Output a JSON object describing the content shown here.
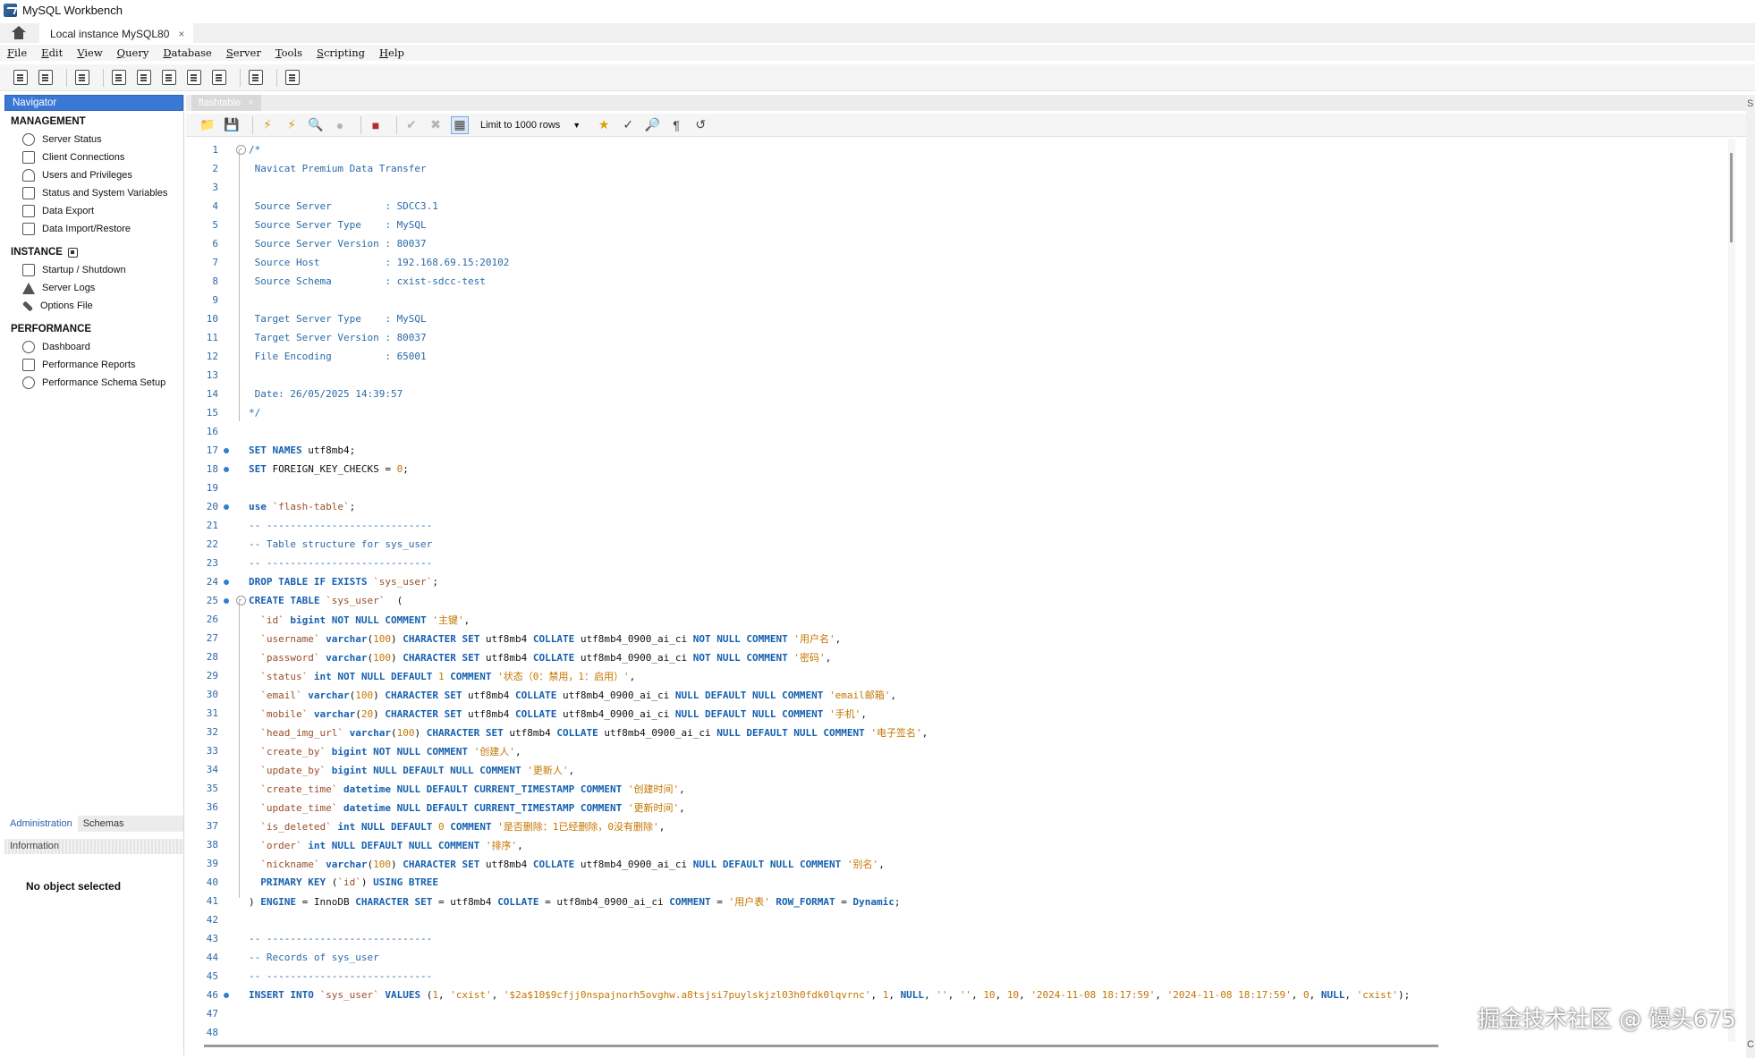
{
  "window": {
    "title": "MySQL Workbench"
  },
  "connection_tab": {
    "label": "Local instance MySQL80",
    "close": "×"
  },
  "menu": [
    {
      "mn": "F",
      "rest": "ile"
    },
    {
      "mn": "E",
      "rest": "dit"
    },
    {
      "mn": "V",
      "rest": "iew"
    },
    {
      "mn": "Q",
      "rest": "uery"
    },
    {
      "mn": "D",
      "rest": "atabase"
    },
    {
      "mn": "S",
      "rest": "erver"
    },
    {
      "mn": "T",
      "rest": "ools"
    },
    {
      "mn": "S",
      "rest": "cripting"
    },
    {
      "mn": "H",
      "rest": "elp"
    }
  ],
  "navigator": {
    "header": "Navigator",
    "management_title": "MANAGEMENT",
    "management": [
      "Server Status",
      "Client Connections",
      "Users and Privileges",
      "Status and System Variables",
      "Data Export",
      "Data Import/Restore"
    ],
    "instance_title": "INSTANCE",
    "instance": [
      "Startup / Shutdown",
      "Server Logs",
      "Options File"
    ],
    "performance_title": "PERFORMANCE",
    "performance": [
      "Dashboard",
      "Performance Reports",
      "Performance Schema Setup"
    ],
    "tabs": [
      "Administration",
      "Schemas"
    ],
    "info_header": "Information",
    "no_object": "No object selected"
  },
  "editor": {
    "tab_label": "flashtable",
    "tab_close": "×",
    "limit_label": "Limit to 1000 rows",
    "right_tab_text": "S",
    "right_tab_text2": "C"
  },
  "watermark": "掘金技术社区 @ 馒头675",
  "code_lines": [
    {
      "n": "1",
      "m": "",
      "f": "-",
      "t": [
        [
          "cm",
          "/*"
        ]
      ]
    },
    {
      "n": "2",
      "m": "",
      "f": "",
      "t": [
        [
          "cm",
          " Navicat Premium Data Transfer"
        ]
      ]
    },
    {
      "n": "3",
      "m": "",
      "f": "",
      "t": []
    },
    {
      "n": "4",
      "m": "",
      "f": "",
      "t": [
        [
          "cm",
          " Source Server         : SDCC3.1"
        ]
      ]
    },
    {
      "n": "5",
      "m": "",
      "f": "",
      "t": [
        [
          "cm",
          " Source Server Type    : MySQL"
        ]
      ]
    },
    {
      "n": "6",
      "m": "",
      "f": "",
      "t": [
        [
          "cm",
          " Source Server Version : 80037"
        ]
      ]
    },
    {
      "n": "7",
      "m": "",
      "f": "",
      "t": [
        [
          "cm",
          " Source Host           : 192.168.69.15:20102"
        ]
      ]
    },
    {
      "n": "8",
      "m": "",
      "f": "",
      "t": [
        [
          "cm",
          " Source Schema         : cxist-sdcc-test"
        ]
      ]
    },
    {
      "n": "9",
      "m": "",
      "f": "",
      "t": []
    },
    {
      "n": "10",
      "m": "",
      "f": "",
      "t": [
        [
          "cm",
          " Target Server Type    : MySQL"
        ]
      ]
    },
    {
      "n": "11",
      "m": "",
      "f": "",
      "t": [
        [
          "cm",
          " Target Server Version : 80037"
        ]
      ]
    },
    {
      "n": "12",
      "m": "",
      "f": "",
      "t": [
        [
          "cm",
          " File Encoding         : 65001"
        ]
      ]
    },
    {
      "n": "13",
      "m": "",
      "f": "",
      "t": []
    },
    {
      "n": "14",
      "m": "",
      "f": "",
      "t": [
        [
          "cm",
          " Date: 26/05/2025 14:39:57"
        ]
      ]
    },
    {
      "n": "15",
      "m": "",
      "f": "",
      "t": [
        [
          "cm",
          "*/"
        ]
      ]
    },
    {
      "n": "16",
      "m": "",
      "f": "",
      "t": []
    },
    {
      "n": "17",
      "m": "dot",
      "f": "",
      "t": [
        [
          "kw",
          "SET NAMES"
        ],
        [
          "pl",
          " utf8mb4;"
        ]
      ]
    },
    {
      "n": "18",
      "m": "dot",
      "f": "",
      "t": [
        [
          "kw",
          "SET"
        ],
        [
          "pl",
          " FOREIGN_KEY_CHECKS = "
        ],
        [
          "nm",
          "0"
        ],
        [
          "pl",
          ";"
        ]
      ]
    },
    {
      "n": "19",
      "m": "",
      "f": "",
      "t": []
    },
    {
      "n": "20",
      "m": "dot",
      "f": "",
      "t": [
        [
          "kw",
          "use"
        ],
        [
          "pl",
          " "
        ],
        [
          "id",
          "`flash-table`"
        ],
        [
          "pl",
          ";"
        ]
      ]
    },
    {
      "n": "21",
      "m": "",
      "f": "",
      "t": [
        [
          "cm",
          "-- ----------------------------"
        ]
      ]
    },
    {
      "n": "22",
      "m": "",
      "f": "",
      "t": [
        [
          "cm",
          "-- Table structure for sys_user"
        ]
      ]
    },
    {
      "n": "23",
      "m": "",
      "f": "",
      "t": [
        [
          "cm",
          "-- ----------------------------"
        ]
      ]
    },
    {
      "n": "24",
      "m": "dot",
      "f": "",
      "t": [
        [
          "kw",
          "DROP TABLE IF EXISTS"
        ],
        [
          "pl",
          " "
        ],
        [
          "id",
          "`sys_user`"
        ],
        [
          "pl",
          ";"
        ]
      ]
    },
    {
      "n": "25",
      "m": "dot",
      "f": "-",
      "t": [
        [
          "kw",
          "CREATE TABLE"
        ],
        [
          "pl",
          " "
        ],
        [
          "id",
          "`sys_user`"
        ],
        [
          "pl",
          "  ("
        ]
      ]
    },
    {
      "n": "26",
      "m": "",
      "f": "",
      "t": [
        [
          "pl",
          "  "
        ],
        [
          "id",
          "`id`"
        ],
        [
          "pl",
          " "
        ],
        [
          "kw",
          "bigint NOT NULL COMMENT"
        ],
        [
          "pl",
          " "
        ],
        [
          "st",
          "'主键'"
        ],
        [
          "pl",
          ","
        ]
      ]
    },
    {
      "n": "27",
      "m": "",
      "f": "",
      "t": [
        [
          "pl",
          "  "
        ],
        [
          "id",
          "`username`"
        ],
        [
          "pl",
          " "
        ],
        [
          "kw",
          "varchar"
        ],
        [
          "pl",
          "("
        ],
        [
          "nm",
          "100"
        ],
        [
          "pl",
          ") "
        ],
        [
          "kw",
          "CHARACTER SET"
        ],
        [
          "pl",
          " utf8mb4 "
        ],
        [
          "kw",
          "COLLATE"
        ],
        [
          "pl",
          " utf8mb4_0900_ai_ci "
        ],
        [
          "kw",
          "NOT NULL COMMENT"
        ],
        [
          "pl",
          " "
        ],
        [
          "st",
          "'用户名'"
        ],
        [
          "pl",
          ","
        ]
      ]
    },
    {
      "n": "28",
      "m": "",
      "f": "",
      "t": [
        [
          "pl",
          "  "
        ],
        [
          "id",
          "`password`"
        ],
        [
          "pl",
          " "
        ],
        [
          "kw",
          "varchar"
        ],
        [
          "pl",
          "("
        ],
        [
          "nm",
          "100"
        ],
        [
          "pl",
          ") "
        ],
        [
          "kw",
          "CHARACTER SET"
        ],
        [
          "pl",
          " utf8mb4 "
        ],
        [
          "kw",
          "COLLATE"
        ],
        [
          "pl",
          " utf8mb4_0900_ai_ci "
        ],
        [
          "kw",
          "NOT NULL COMMENT"
        ],
        [
          "pl",
          " "
        ],
        [
          "st",
          "'密码'"
        ],
        [
          "pl",
          ","
        ]
      ]
    },
    {
      "n": "29",
      "m": "",
      "f": "",
      "t": [
        [
          "pl",
          "  "
        ],
        [
          "id",
          "`status`"
        ],
        [
          "pl",
          " "
        ],
        [
          "kw",
          "int NOT NULL DEFAULT"
        ],
        [
          "pl",
          " "
        ],
        [
          "nm",
          "1"
        ],
        [
          "pl",
          " "
        ],
        [
          "kw",
          "COMMENT"
        ],
        [
          "pl",
          " "
        ],
        [
          "st",
          "'状态（0：禁用，1：启用）'"
        ],
        [
          "pl",
          ","
        ]
      ]
    },
    {
      "n": "30",
      "m": "",
      "f": "",
      "t": [
        [
          "pl",
          "  "
        ],
        [
          "id",
          "`email`"
        ],
        [
          "pl",
          " "
        ],
        [
          "kw",
          "varchar"
        ],
        [
          "pl",
          "("
        ],
        [
          "nm",
          "100"
        ],
        [
          "pl",
          ") "
        ],
        [
          "kw",
          "CHARACTER SET"
        ],
        [
          "pl",
          " utf8mb4 "
        ],
        [
          "kw",
          "COLLATE"
        ],
        [
          "pl",
          " utf8mb4_0900_ai_ci "
        ],
        [
          "kw",
          "NULL DEFAULT NULL COMMENT"
        ],
        [
          "pl",
          " "
        ],
        [
          "st",
          "'email邮箱'"
        ],
        [
          "pl",
          ","
        ]
      ]
    },
    {
      "n": "31",
      "m": "",
      "f": "",
      "t": [
        [
          "pl",
          "  "
        ],
        [
          "id",
          "`mobile`"
        ],
        [
          "pl",
          " "
        ],
        [
          "kw",
          "varchar"
        ],
        [
          "pl",
          "("
        ],
        [
          "nm",
          "20"
        ],
        [
          "pl",
          ") "
        ],
        [
          "kw",
          "CHARACTER SET"
        ],
        [
          "pl",
          " utf8mb4 "
        ],
        [
          "kw",
          "COLLATE"
        ],
        [
          "pl",
          " utf8mb4_0900_ai_ci "
        ],
        [
          "kw",
          "NULL DEFAULT NULL COMMENT"
        ],
        [
          "pl",
          " "
        ],
        [
          "st",
          "'手机'"
        ],
        [
          "pl",
          ","
        ]
      ]
    },
    {
      "n": "32",
      "m": "",
      "f": "",
      "t": [
        [
          "pl",
          "  "
        ],
        [
          "id",
          "`head_img_url`"
        ],
        [
          "pl",
          " "
        ],
        [
          "kw",
          "varchar"
        ],
        [
          "pl",
          "("
        ],
        [
          "nm",
          "100"
        ],
        [
          "pl",
          ") "
        ],
        [
          "kw",
          "CHARACTER SET"
        ],
        [
          "pl",
          " utf8mb4 "
        ],
        [
          "kw",
          "COLLATE"
        ],
        [
          "pl",
          " utf8mb4_0900_ai_ci "
        ],
        [
          "kw",
          "NULL DEFAULT NULL COMMENT"
        ],
        [
          "pl",
          " "
        ],
        [
          "st",
          "'电子签名'"
        ],
        [
          "pl",
          ","
        ]
      ]
    },
    {
      "n": "33",
      "m": "",
      "f": "",
      "t": [
        [
          "pl",
          "  "
        ],
        [
          "id",
          "`create_by`"
        ],
        [
          "pl",
          " "
        ],
        [
          "kw",
          "bigint NOT NULL COMMENT"
        ],
        [
          "pl",
          " "
        ],
        [
          "st",
          "'创建人'"
        ],
        [
          "pl",
          ","
        ]
      ]
    },
    {
      "n": "34",
      "m": "",
      "f": "",
      "t": [
        [
          "pl",
          "  "
        ],
        [
          "id",
          "`update_by`"
        ],
        [
          "pl",
          " "
        ],
        [
          "kw",
          "bigint NULL DEFAULT NULL COMMENT"
        ],
        [
          "pl",
          " "
        ],
        [
          "st",
          "'更新人'"
        ],
        [
          "pl",
          ","
        ]
      ]
    },
    {
      "n": "35",
      "m": "",
      "f": "",
      "t": [
        [
          "pl",
          "  "
        ],
        [
          "id",
          "`create_time`"
        ],
        [
          "pl",
          " "
        ],
        [
          "kw",
          "datetime NULL DEFAULT CURRENT_TIMESTAMP COMMENT"
        ],
        [
          "pl",
          " "
        ],
        [
          "st",
          "'创建时间'"
        ],
        [
          "pl",
          ","
        ]
      ]
    },
    {
      "n": "36",
      "m": "",
      "f": "",
      "t": [
        [
          "pl",
          "  "
        ],
        [
          "id",
          "`update_time`"
        ],
        [
          "pl",
          " "
        ],
        [
          "kw",
          "datetime NULL DEFAULT CURRENT_TIMESTAMP COMMENT"
        ],
        [
          "pl",
          " "
        ],
        [
          "st",
          "'更新时间'"
        ],
        [
          "pl",
          ","
        ]
      ]
    },
    {
      "n": "37",
      "m": "",
      "f": "",
      "t": [
        [
          "pl",
          "  "
        ],
        [
          "id",
          "`is_deleted`"
        ],
        [
          "pl",
          " "
        ],
        [
          "kw",
          "int NULL DEFAULT"
        ],
        [
          "pl",
          " "
        ],
        [
          "nm",
          "0"
        ],
        [
          "pl",
          " "
        ],
        [
          "kw",
          "COMMENT"
        ],
        [
          "pl",
          " "
        ],
        [
          "st",
          "'是否删除：1已经删除，0没有删除'"
        ],
        [
          "pl",
          ","
        ]
      ]
    },
    {
      "n": "38",
      "m": "",
      "f": "",
      "t": [
        [
          "pl",
          "  "
        ],
        [
          "id",
          "`order`"
        ],
        [
          "pl",
          " "
        ],
        [
          "kw",
          "int NULL DEFAULT NULL COMMENT"
        ],
        [
          "pl",
          " "
        ],
        [
          "st",
          "'排序'"
        ],
        [
          "pl",
          ","
        ]
      ]
    },
    {
      "n": "39",
      "m": "",
      "f": "",
      "t": [
        [
          "pl",
          "  "
        ],
        [
          "id",
          "`nickname`"
        ],
        [
          "pl",
          " "
        ],
        [
          "kw",
          "varchar"
        ],
        [
          "pl",
          "("
        ],
        [
          "nm",
          "100"
        ],
        [
          "pl",
          ") "
        ],
        [
          "kw",
          "CHARACTER SET"
        ],
        [
          "pl",
          " utf8mb4 "
        ],
        [
          "kw",
          "COLLATE"
        ],
        [
          "pl",
          " utf8mb4_0900_ai_ci "
        ],
        [
          "kw",
          "NULL DEFAULT NULL COMMENT"
        ],
        [
          "pl",
          " "
        ],
        [
          "st",
          "'别名'"
        ],
        [
          "pl",
          ","
        ]
      ]
    },
    {
      "n": "40",
      "m": "",
      "f": "",
      "t": [
        [
          "pl",
          "  "
        ],
        [
          "kw",
          "PRIMARY KEY"
        ],
        [
          "pl",
          " ("
        ],
        [
          "id",
          "`id`"
        ],
        [
          "pl",
          ") "
        ],
        [
          "kw",
          "USING BTREE"
        ]
      ]
    },
    {
      "n": "41",
      "m": "",
      "f": "",
      "t": [
        [
          "pl",
          ") "
        ],
        [
          "kw",
          "ENGINE"
        ],
        [
          "pl",
          " = InnoDB "
        ],
        [
          "kw",
          "CHARACTER SET"
        ],
        [
          "pl",
          " = utf8mb4 "
        ],
        [
          "kw",
          "COLLATE"
        ],
        [
          "pl",
          " = utf8mb4_0900_ai_ci "
        ],
        [
          "kw",
          "COMMENT"
        ],
        [
          "pl",
          " = "
        ],
        [
          "st",
          "'用户表'"
        ],
        [
          "pl",
          " "
        ],
        [
          "kw",
          "ROW_FORMAT"
        ],
        [
          "pl",
          " = "
        ],
        [
          "kw",
          "Dynamic"
        ],
        [
          "pl",
          ";"
        ]
      ]
    },
    {
      "n": "42",
      "m": "",
      "f": "",
      "t": []
    },
    {
      "n": "43",
      "m": "",
      "f": "",
      "t": [
        [
          "cm",
          "-- ----------------------------"
        ]
      ]
    },
    {
      "n": "44",
      "m": "",
      "f": "",
      "t": [
        [
          "cm",
          "-- Records of sys_user"
        ]
      ]
    },
    {
      "n": "45",
      "m": "",
      "f": "",
      "t": [
        [
          "cm",
          "-- ----------------------------"
        ]
      ]
    },
    {
      "n": "46",
      "m": "dot",
      "f": "",
      "t": [
        [
          "kw",
          "INSERT INTO"
        ],
        [
          "pl",
          " "
        ],
        [
          "id",
          "`sys_user`"
        ],
        [
          "pl",
          " "
        ],
        [
          "kw",
          "VALUES"
        ],
        [
          "pl",
          " ("
        ],
        [
          "nm",
          "1"
        ],
        [
          "pl",
          ", "
        ],
        [
          "st",
          "'cxist'"
        ],
        [
          "pl",
          ", "
        ],
        [
          "st",
          "'$2a$10$9cfjj0nspajnorh5ovghw.a8tsjsi7puylskjzl03h0fdk0lqvrnc'"
        ],
        [
          "pl",
          ", "
        ],
        [
          "nm",
          "1"
        ],
        [
          "pl",
          ", "
        ],
        [
          "kw",
          "NULL"
        ],
        [
          "pl",
          ", "
        ],
        [
          "st",
          "''"
        ],
        [
          "pl",
          ", "
        ],
        [
          "st",
          "''"
        ],
        [
          "pl",
          ", "
        ],
        [
          "nm",
          "10"
        ],
        [
          "pl",
          ", "
        ],
        [
          "nm",
          "10"
        ],
        [
          "pl",
          ", "
        ],
        [
          "st",
          "'2024-11-08 18:17:59'"
        ],
        [
          "pl",
          ", "
        ],
        [
          "st",
          "'2024-11-08 18:17:59'"
        ],
        [
          "pl",
          ", "
        ],
        [
          "nm",
          "0"
        ],
        [
          "pl",
          ", "
        ],
        [
          "kw",
          "NULL"
        ],
        [
          "pl",
          ", "
        ],
        [
          "st",
          "'cxist'"
        ],
        [
          "pl",
          ");"
        ]
      ]
    },
    {
      "n": "47",
      "m": "",
      "f": "",
      "t": []
    },
    {
      "n": "48",
      "m": "",
      "f": "",
      "t": []
    }
  ]
}
